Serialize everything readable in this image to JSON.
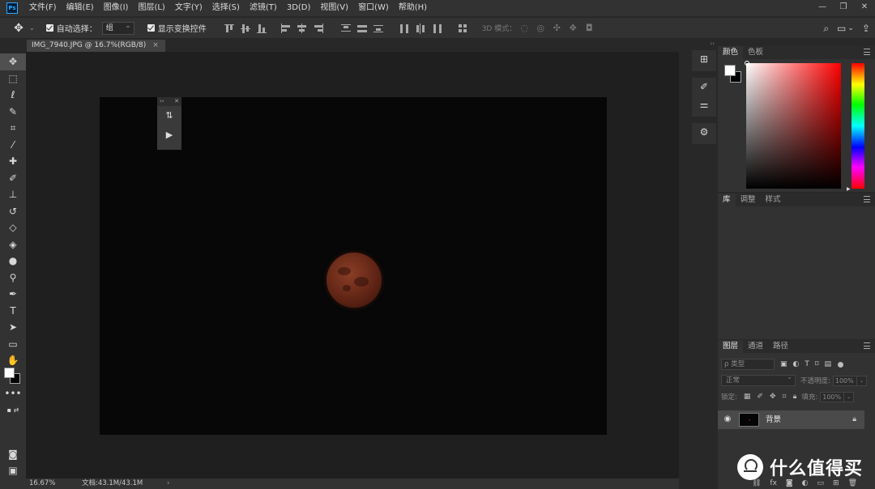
{
  "app": {
    "logo": "Ps"
  },
  "menu": [
    "文件(F)",
    "编辑(E)",
    "图像(I)",
    "图层(L)",
    "文字(Y)",
    "选择(S)",
    "滤镜(T)",
    "3D(D)",
    "视图(V)",
    "窗口(W)",
    "帮助(H)"
  ],
  "window_controls": {
    "minimize": "—",
    "restore": "❐",
    "close": "✕"
  },
  "options": {
    "tool_icon": "move-icon",
    "auto_select_label": "自动选择：",
    "auto_select_value": "组",
    "transform_label": "显示变换控件",
    "mode_3d_label": "3D 模式："
  },
  "document": {
    "tab_title": "IMG_7940.JPG @ 16.7%(RGB/8)",
    "tab_close": "×"
  },
  "status": {
    "zoom": "16.67%",
    "doc_size": "文档:43.1M/43.1M",
    "arrow": "›"
  },
  "color_panel": {
    "tabs": [
      "颜色",
      "色板"
    ],
    "active": 0,
    "foreground": "#ffffff",
    "background": "#000000"
  },
  "library_panel": {
    "tabs": [
      "库",
      "调整",
      "样式"
    ],
    "active": 0
  },
  "layers_panel": {
    "tabs": [
      "图层",
      "通道",
      "路径"
    ],
    "active": 0,
    "filter_placeholder": "ρ 类型",
    "blend_mode": "正常",
    "opacity_label": "不透明度:",
    "opacity_value": "100%",
    "lock_label": "锁定:",
    "fill_label": "填充:",
    "fill_value": "100%",
    "layers": [
      {
        "name": "背景",
        "visible": true,
        "locked": true
      }
    ]
  },
  "watermark": {
    "text": "什么值得买",
    "logo": "值"
  }
}
